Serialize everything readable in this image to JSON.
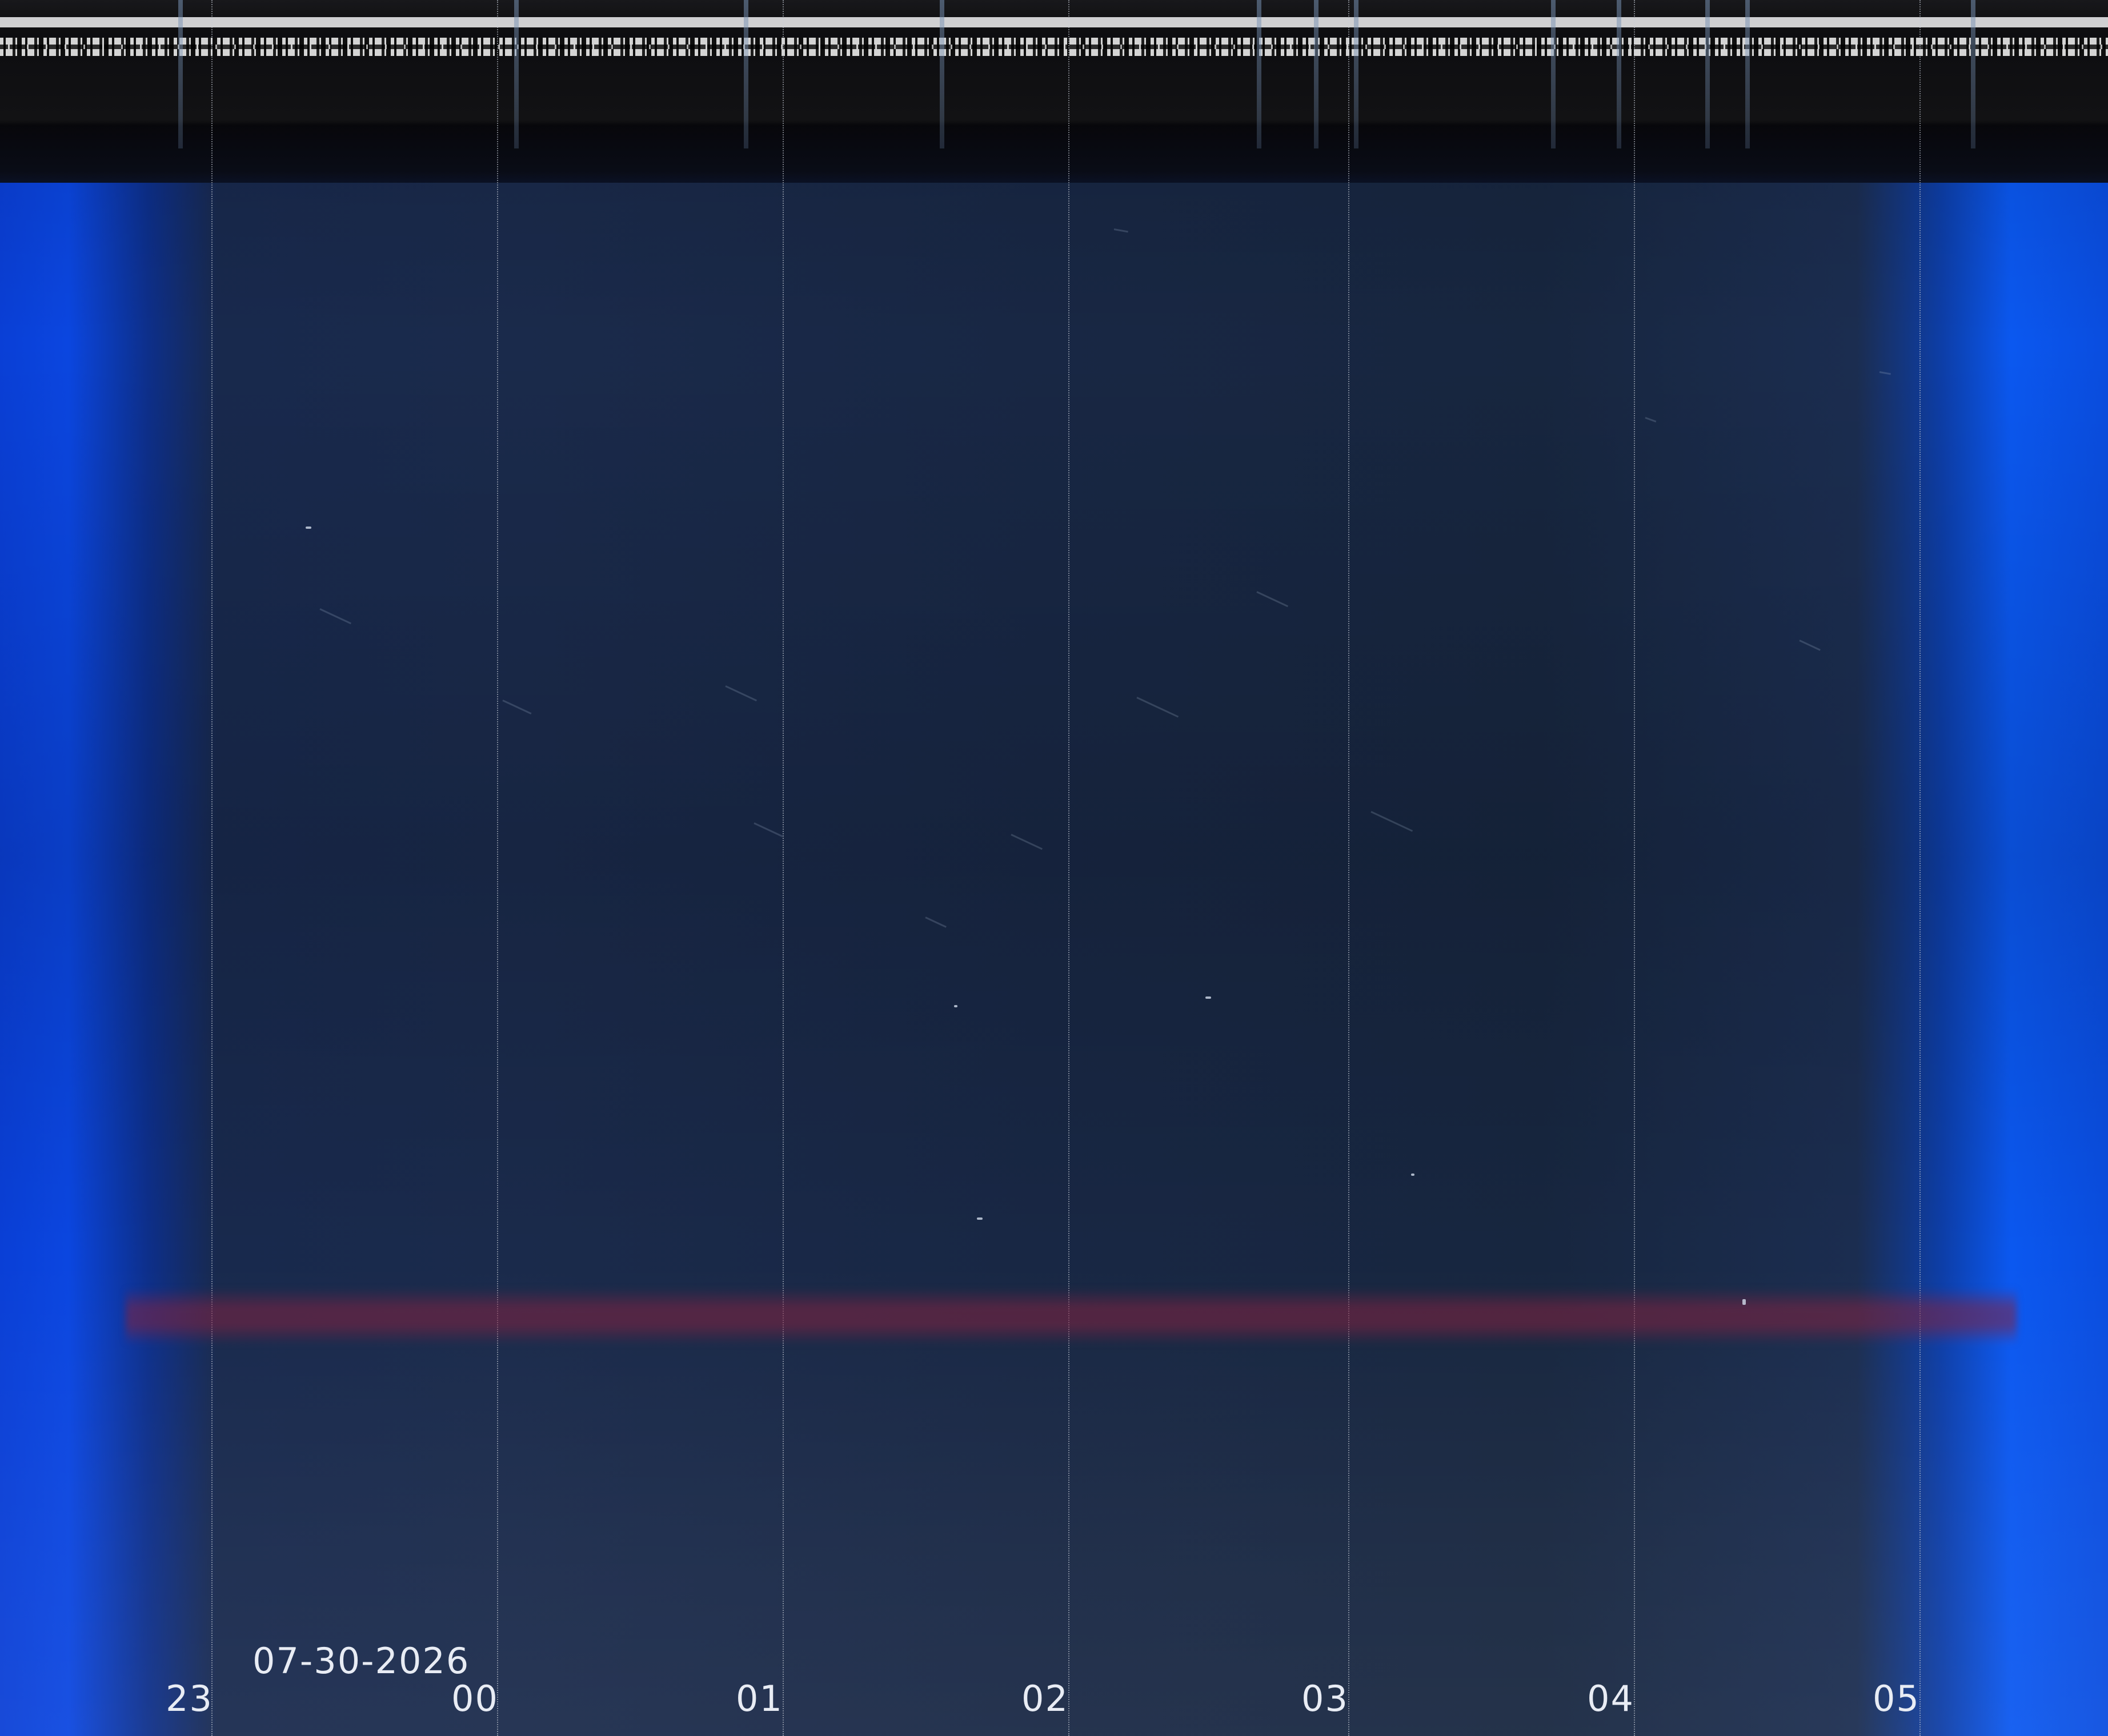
{
  "date": "07-30-2026",
  "hour_labels": [
    "23",
    "00",
    "01",
    "02",
    "03",
    "04",
    "05"
  ],
  "colors": {
    "sky": "#1a2a4b",
    "edge_blue": "#0a4ddf",
    "band_red": "#82233f",
    "label": "#e8ecf4"
  }
}
